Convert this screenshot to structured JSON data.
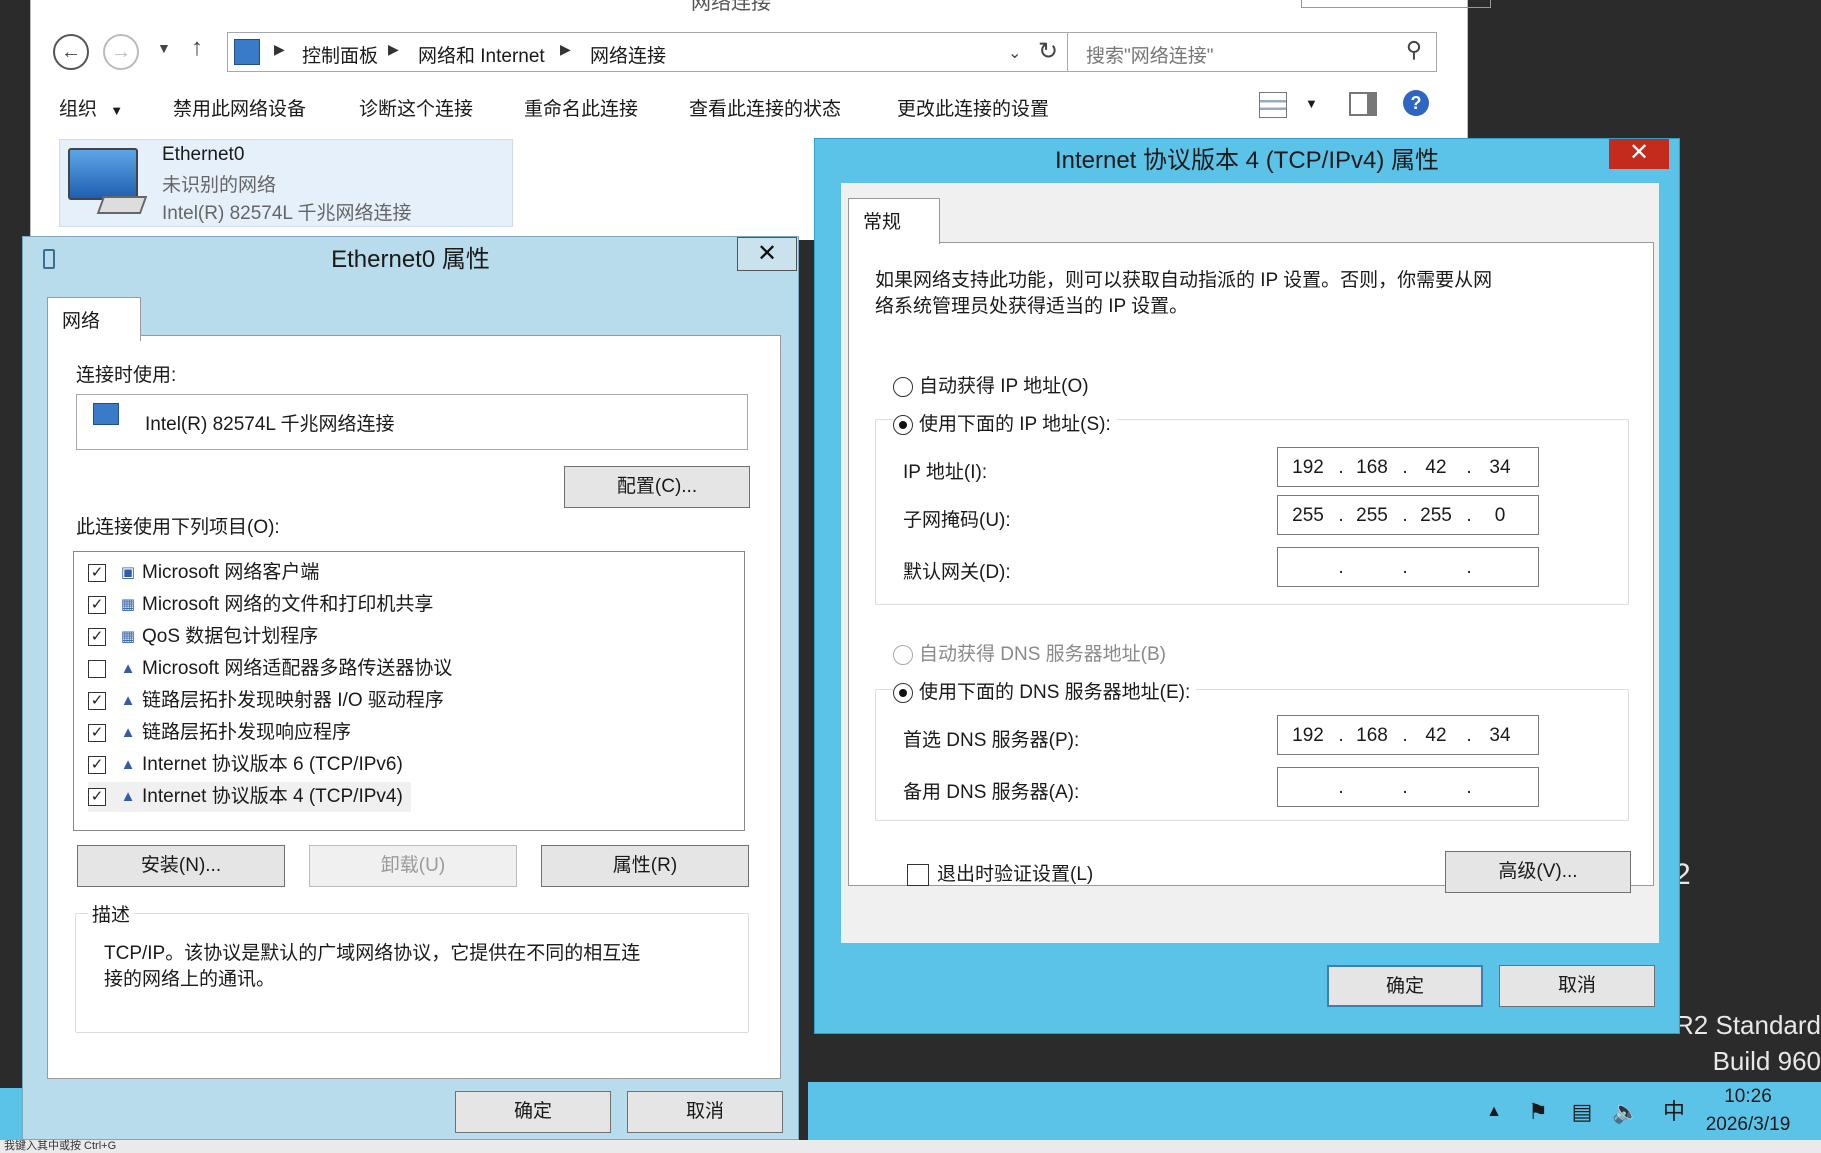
{
  "explorer": {
    "window_title": "网络连接",
    "breadcrumbs": [
      "控制面板",
      "网络和 Internet",
      "网络连接"
    ],
    "search_placeholder": "搜索\"网络连接\"",
    "commands": [
      "组织",
      "禁用此网络设备",
      "诊断这个连接",
      "重命名此连接",
      "查看此连接的状态",
      "更改此连接的设置"
    ],
    "connection": {
      "name": "Ethernet0",
      "status": "未识别的网络",
      "adapter": "Intel(R) 82574L 千兆网络连接"
    }
  },
  "eth_dialog": {
    "title": "Ethernet0 属性",
    "tab": "网络",
    "connect_using_label": "连接时使用:",
    "adapter": "Intel(R) 82574L 千兆网络连接",
    "configure_button": "配置(C)...",
    "items_label": "此连接使用下列项目(O):",
    "items": [
      {
        "label": "Microsoft 网络客户端",
        "checked": true
      },
      {
        "label": "Microsoft 网络的文件和打印机共享",
        "checked": true
      },
      {
        "label": "QoS 数据包计划程序",
        "checked": true
      },
      {
        "label": "Microsoft 网络适配器多路传送器协议",
        "checked": false
      },
      {
        "label": "链路层拓扑发现映射器 I/O 驱动程序",
        "checked": true
      },
      {
        "label": "链路层拓扑发现响应程序",
        "checked": true
      },
      {
        "label": "Internet 协议版本 6 (TCP/IPv6)",
        "checked": true
      },
      {
        "label": "Internet 协议版本 4 (TCP/IPv4)",
        "checked": true
      }
    ],
    "install_button": "安装(N)...",
    "uninstall_button": "卸载(U)",
    "properties_button": "属性(R)",
    "description_label": "描述",
    "description_line1": "TCP/IP。该协议是默认的广域网络协议，它提供在不同的相互连",
    "description_line2": "接的网络上的通讯。",
    "ok_button": "确定",
    "cancel_button": "取消"
  },
  "ipv4_dialog": {
    "title": "Internet 协议版本 4 (TCP/IPv4) 属性",
    "tab": "常规",
    "info_line1": "如果网络支持此功能，则可以获取自动指派的 IP 设置。否则，你需要从网",
    "info_line2": "络系统管理员处获得适当的 IP 设置。",
    "auto_ip_label": "自动获得 IP 地址(O)",
    "manual_ip_label": "使用下面的 IP 地址(S):",
    "ip_label": "IP 地址(I):",
    "ip_value": [
      "192",
      "168",
      "42",
      "34"
    ],
    "mask_label": "子网掩码(U):",
    "mask_value": [
      "255",
      "255",
      "255",
      "0"
    ],
    "gateway_label": "默认网关(D):",
    "gateway_value": [
      "",
      "",
      "",
      ""
    ],
    "auto_dns_label": "自动获得 DNS 服务器地址(B)",
    "manual_dns_label": "使用下面的 DNS 服务器地址(E):",
    "pref_dns_label": "首选 DNS 服务器(P):",
    "pref_dns_value": [
      "192",
      "168",
      "42",
      "34"
    ],
    "alt_dns_label": "备用 DNS 服务器(A):",
    "alt_dns_value": [
      "",
      "",
      "",
      ""
    ],
    "validate_label": "退出时验证设置(L)",
    "advanced_button": "高级(V)...",
    "ok_button": "确定",
    "cancel_button": "取消"
  },
  "desktop": {
    "os_line1": "R2 Standard",
    "os_line2": "Build 960",
    "partial_glyph": "2"
  },
  "taskbar": {
    "time": "10:26",
    "date": "2026/3/19",
    "ime": "中"
  },
  "statusbar": {
    "text": "我键入其中或按 Ctrl+G"
  }
}
